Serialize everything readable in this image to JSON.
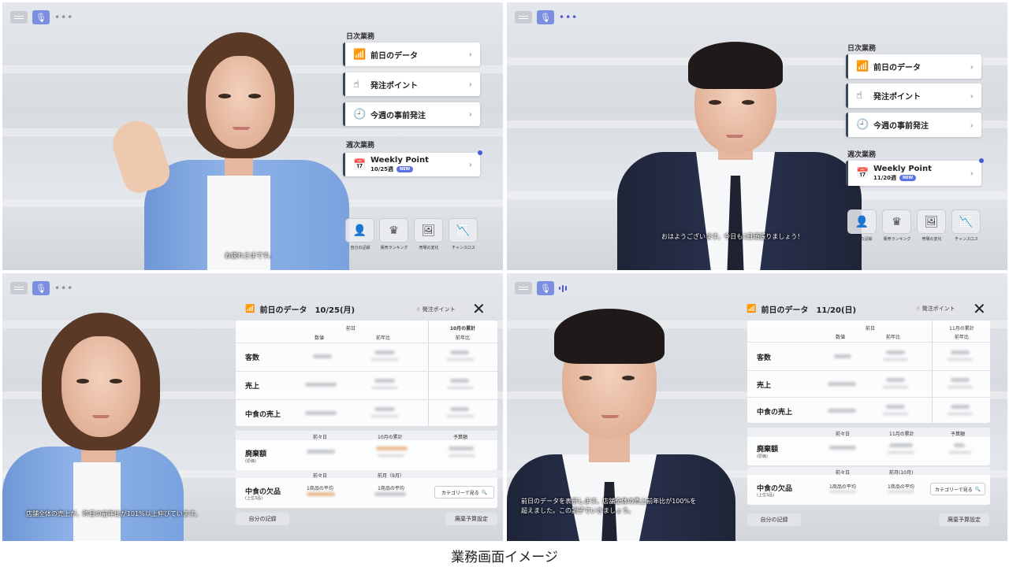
{
  "toolbar": {
    "kbd": "keyboard-icon",
    "mic": "microphone-icon",
    "more": "•••"
  },
  "home": {
    "daily_title": "日次業務",
    "weekly_title": "週次業務",
    "items": [
      {
        "label": "前日のデータ"
      },
      {
        "label": "発注ポイント"
      },
      {
        "label": "今週の事前発注"
      }
    ],
    "weekly_label": "Weekly Point",
    "weekly_new": "NEW"
  },
  "panel1": {
    "weekly_date": "10/25週",
    "bottom": [
      "自分の記録",
      "販売ランキング",
      "売場の変化",
      "チャンスロス"
    ],
    "speech": "お疲れさまです。"
  },
  "panel2": {
    "weekly_date": "11/20週",
    "bottom": [
      "自分の記録",
      "販売ランキング",
      "売場の変化",
      "チャンスロス"
    ],
    "speech": "おはようございます。今日も1日頑張りましょう！"
  },
  "data_common": {
    "title": "前日のデータ",
    "order_point": "発注ポイント",
    "prev_day": "前日",
    "value": "数値",
    "yoy": "前年比",
    "rows": [
      "客数",
      "売上",
      "中食の売上"
    ],
    "prev2": "前々日",
    "budget": "予算額",
    "waste": "廃棄額",
    "waste_sub": "(原価)",
    "missing": "中食の欠品",
    "missing_sub": "(上位3品)",
    "avg": "1商品の平均",
    "category_btn": "カテゴリーで見る",
    "my_record": "自分の記録",
    "budget_btn": "廃棄予算設定"
  },
  "panel3": {
    "date": "10/25(月)",
    "cum_title": "10月の累計",
    "cum_yoy": "前年比",
    "month_cum": "10月の累計",
    "prev_month": "前月（9月）",
    "speech": "店舗全体の売上が、昨日の前年比が101%以上伸びています。"
  },
  "panel4": {
    "date": "11/20(日)",
    "cum_title": "11月の累計",
    "cum_yoy": "前年比",
    "month_cum": "11月の累計",
    "prev_month": "前月(10月)",
    "speech": "前日のデータを表示します。店舗全体の売上前年比が100%を\n超えました。この調子でいきましょう。"
  },
  "caption": "業務画面イメージ"
}
